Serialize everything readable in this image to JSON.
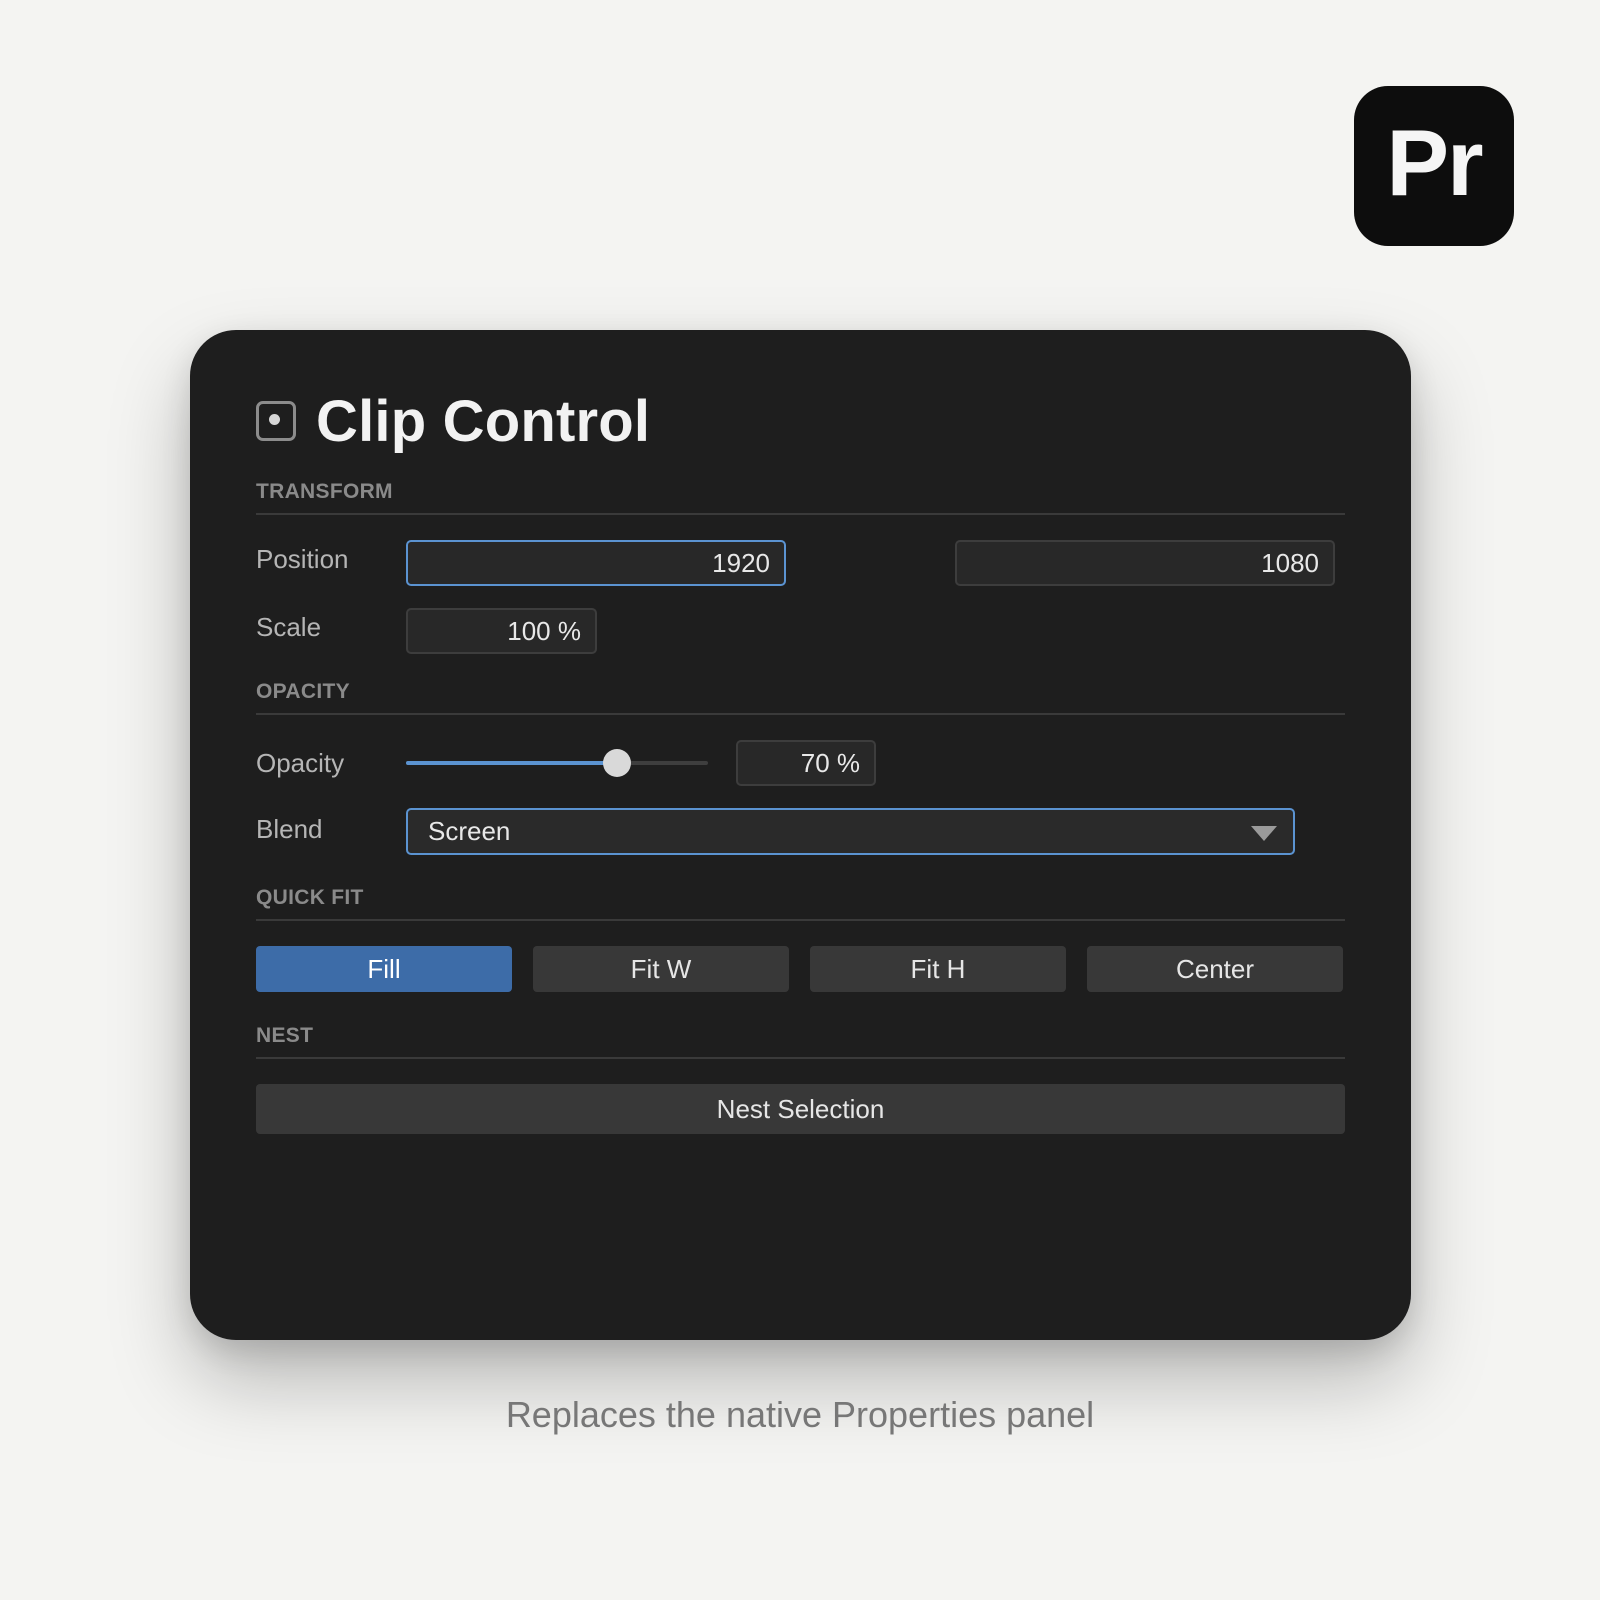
{
  "app_logo": {
    "text": "Pr",
    "background": "#0d0d0d"
  },
  "panel": {
    "icon": "clip-frame-icon",
    "title": "Clip Control"
  },
  "transform": {
    "header": "TRANSFORM",
    "position": {
      "label": "Position",
      "x": "1920",
      "y": "1080"
    },
    "scale": {
      "label": "Scale",
      "value": "100 %"
    }
  },
  "opacity": {
    "header": "OPACITY",
    "label": "Opacity",
    "slider_level": 0.7,
    "value": "70 %",
    "blend": {
      "label": "Blend",
      "selected": "Screen"
    }
  },
  "quick_fit": {
    "header": "QUICK FIT",
    "buttons": [
      {
        "label": "Fill",
        "active": true
      },
      {
        "label": "Fit W",
        "active": false
      },
      {
        "label": "Fit H",
        "active": false
      },
      {
        "label": "Center",
        "active": false
      }
    ]
  },
  "nest": {
    "header": "NEST",
    "button_label": "Nest Selection"
  },
  "caption": "Replaces the native Properties panel",
  "colors": {
    "accent": "#5b93d1",
    "active_button": "#3d6ca8",
    "panel_bg": "#1e1e1e",
    "page_bg": "#f4f4f2"
  }
}
